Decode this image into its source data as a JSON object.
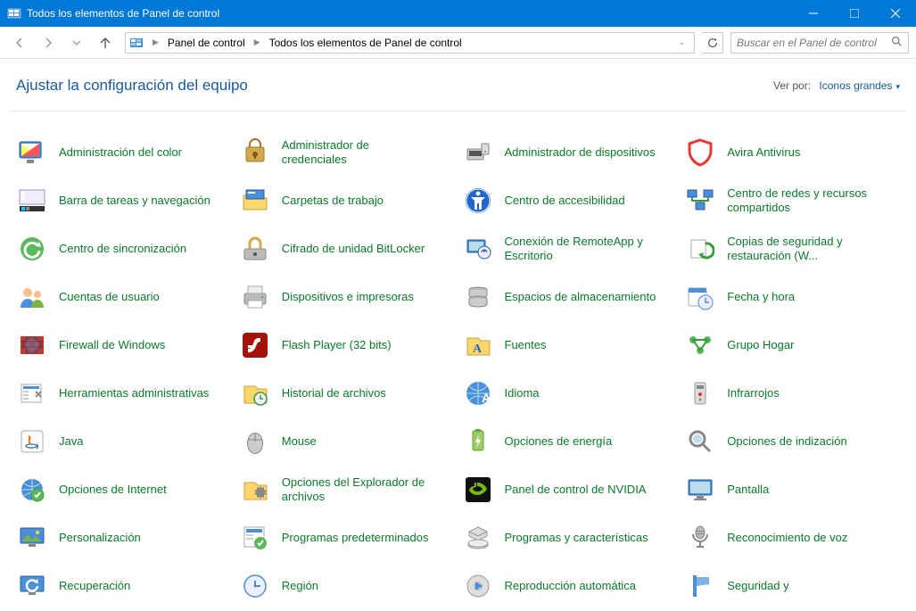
{
  "window": {
    "title": "Todos los elementos de Panel de control"
  },
  "breadcrumb": {
    "parts": [
      "Panel de control",
      "Todos los elementos de Panel de control"
    ]
  },
  "search": {
    "placeholder": "Buscar en el Panel de control"
  },
  "header": {
    "title": "Ajustar la configuración del equipo",
    "view_label": "Ver por:",
    "view_value": "Iconos grandes"
  },
  "items": [
    {
      "icon": "color-management-icon",
      "label": "Administración del color"
    },
    {
      "icon": "credential-manager-icon",
      "label": "Administrador de credenciales"
    },
    {
      "icon": "device-manager-icon",
      "label": "Administrador de dispositivos"
    },
    {
      "icon": "avira-icon",
      "label": "Avira Antivirus"
    },
    {
      "icon": "taskbar-icon",
      "label": "Barra de tareas y navegación"
    },
    {
      "icon": "work-folders-icon",
      "label": "Carpetas de trabajo"
    },
    {
      "icon": "ease-of-access-icon",
      "label": "Centro de accesibilidad"
    },
    {
      "icon": "network-sharing-icon",
      "label": "Centro de redes y recursos compartidos"
    },
    {
      "icon": "sync-center-icon",
      "label": "Centro de sincronización"
    },
    {
      "icon": "bitlocker-icon",
      "label": "Cifrado de unidad BitLocker"
    },
    {
      "icon": "remoteapp-icon",
      "label": "Conexión de RemoteApp y Escritorio"
    },
    {
      "icon": "backup-restore-icon",
      "label": "Copias de seguridad y restauración (W..."
    },
    {
      "icon": "user-accounts-icon",
      "label": "Cuentas de usuario"
    },
    {
      "icon": "devices-printers-icon",
      "label": "Dispositivos e impresoras"
    },
    {
      "icon": "storage-spaces-icon",
      "label": "Espacios de almacenamiento"
    },
    {
      "icon": "date-time-icon",
      "label": "Fecha y hora"
    },
    {
      "icon": "firewall-icon",
      "label": "Firewall de Windows"
    },
    {
      "icon": "flash-player-icon",
      "label": "Flash Player (32 bits)"
    },
    {
      "icon": "fonts-icon",
      "label": "Fuentes"
    },
    {
      "icon": "homegroup-icon",
      "label": "Grupo Hogar"
    },
    {
      "icon": "admin-tools-icon",
      "label": "Herramientas administrativas"
    },
    {
      "icon": "file-history-icon",
      "label": "Historial de archivos"
    },
    {
      "icon": "language-icon",
      "label": "Idioma"
    },
    {
      "icon": "infrared-icon",
      "label": "Infrarrojos"
    },
    {
      "icon": "java-icon",
      "label": "Java"
    },
    {
      "icon": "mouse-icon",
      "label": "Mouse"
    },
    {
      "icon": "power-options-icon",
      "label": "Opciones de energía"
    },
    {
      "icon": "indexing-options-icon",
      "label": "Opciones de indización"
    },
    {
      "icon": "internet-options-icon",
      "label": "Opciones de Internet"
    },
    {
      "icon": "folder-options-icon",
      "label": "Opciones del Explorador de archivos"
    },
    {
      "icon": "nvidia-icon",
      "label": "Panel de control de NVIDIA"
    },
    {
      "icon": "display-icon",
      "label": "Pantalla"
    },
    {
      "icon": "personalization-icon",
      "label": "Personalización"
    },
    {
      "icon": "default-programs-icon",
      "label": "Programas predeterminados"
    },
    {
      "icon": "programs-features-icon",
      "label": "Programas y características"
    },
    {
      "icon": "speech-recognition-icon",
      "label": "Reconocimiento de voz"
    },
    {
      "icon": "recovery-icon",
      "label": "Recuperación"
    },
    {
      "icon": "region-icon",
      "label": "Región"
    },
    {
      "icon": "autoplay-icon",
      "label": "Reproducción automática"
    },
    {
      "icon": "security-maintenance-icon",
      "label": "Seguridad y"
    }
  ],
  "icon_svg": {
    "color-management-icon": "<svg viewBox='0 0 32 32'><rect x='2' y='4' width='24' height='18' rx='2' fill='#4a90d9' stroke='#2c5aa0'/><rect x='4' y='6' width='20' height='14' fill='#fff'/><path d='M4 6 L24 20 L4 20 Z' fill='#ff6'/><path d='M24 6 L24 20 L4 20 Z' fill='#f55'/><rect x='10' y='24' width='8' height='4' fill='#888'/></svg>",
    "credential-manager-icon": "<svg viewBox='0 0 32 32'><rect x='6' y='10' width='20' height='16' rx='2' fill='#d4a94c' stroke='#9c7a2e'/><circle cx='16' cy='18' r='3' fill='#7a5c1e'/><rect x='15' y='18' width='2' height='5' fill='#7a5c1e'/><path d='M10 10 V7 a6 6 0 0 1 12 0 V10' fill='none' stroke='#9c7a2e' stroke-width='2'/></svg>",
    "device-manager-icon": "<svg viewBox='0 0 32 32'><rect x='4' y='12' width='18' height='12' rx='1' fill='#ccc' stroke='#888'/><rect x='6' y='14' width='14' height='6' fill='#555'/><rect x='20' y='6' width='8' height='12' rx='1' fill='#ddd' stroke='#888'/><circle cx='24' cy='15' r='1' fill='#888'/></svg>",
    "avira-icon": "<svg viewBox='0 0 32 32'><path d='M16 2 L28 6 V14 C28 22 22 28 16 30 C10 28 4 22 4 14 V6 Z' fill='none' stroke='#e53935' stroke-width='3'/></svg>",
    "taskbar-icon": "<svg viewBox='0 0 32 32'><rect x='2' y='4' width='28' height='16' fill='#eef' stroke='#99b'/><rect x='2' y='22' width='28' height='6' fill='#333'/><rect x='4' y='23' width='4' height='4' fill='#0cf'/><rect x='9' y='23' width='4' height='4' fill='#888'/><rect x='4' y='6' width='4' height='4' fill='#fff'/><rect x='4' y='11' width='4' height='4' fill='#fff'/></svg>",
    "work-folders-icon": "<svg viewBox='0 0 32 32'><path d='M3 10 h10 l3 3 h13 v13 H3 Z' fill='#ffd76a' stroke='#c9a23a'/><rect x='6' y='4' width='20' height='10' fill='#4a90d9' stroke='#2c5aa0'/><rect x='8' y='6' width='8' height='2' fill='#fff'/></svg>",
    "ease-of-access-icon": "<svg viewBox='0 0 32 32'><circle cx='16' cy='16' r='14' fill='#1e66c9'/><circle cx='16' cy='8' r='2.5' fill='#fff'/><path d='M8 12 h16 l-4 4 v10 h-3 v-7 h-2 v7 h-3 v-10 Z' fill='#fff'/><circle cx='16' cy='16' r='13' fill='none' stroke='#fff' stroke-width='1'/></svg>",
    "network-sharing-icon": "<svg viewBox='0 0 32 32'><rect x='2' y='4' width='10' height='8' fill='#4a90d9' stroke='#2c5aa0'/><rect x='20' y='4' width='10' height='8' fill='#4a90d9' stroke='#2c5aa0'/><rect x='11' y='18' width='10' height='8' fill='#4a90d9' stroke='#2c5aa0'/><path d='M7 12 V16 H25 V12 M16 16 V18' stroke='#3a9c3a' stroke-width='2' fill='none'/></svg>",
    "sync-center-icon": "<svg viewBox='0 0 32 32'><circle cx='16' cy='16' r='13' fill='#5cb85c'/><path d='M22 12 a8 8 0 1 0 2 6' fill='none' stroke='#fff' stroke-width='3'/><path d='M24 8 l2 6 l-6 -1 Z' fill='#fff'/></svg>",
    "bitlocker-icon": "<svg viewBox='0 0 32 32'><rect x='4' y='16' width='24' height='12' rx='2' fill='#bbb' stroke='#888'/><path d='M10 16 V10 a6 6 0 0 1 12 0 V16' fill='none' stroke='#d4a94c' stroke-width='3'/><circle cx='16' cy='22' r='2' fill='#555'/></svg>",
    "remoteapp-icon": "<svg viewBox='0 0 32 32'><rect x='4' y='6' width='20' height='14' rx='1' fill='#4a90d9' stroke='#2c5aa0'/><rect x='6' y='8' width='16' height='10' fill='#bde'/><circle cx='23' cy='20' r='7' fill='#eef' stroke='#2c5aa0'/><path d='M20 20 a3 3 0 1 1 6 0' fill='none' stroke='#2c5aa0'/><circle cx='23' cy='18' r='1.5' fill='#2c5aa0'/></svg>",
    "backup-restore-icon": "<svg viewBox='0 0 32 32'><rect x='6' y='6' width='16' height='20' fill='#fff' stroke='#aaa'/><path d='M22 10 a8 8 0 1 1 -4 14' fill='none' stroke='#3a9c3a' stroke-width='3'/><path d='M14 22 l4 4 l2 -6 Z' fill='#3a9c3a'/></svg>",
    "user-accounts-icon": "<svg viewBox='0 0 32 32'><circle cx='11' cy='11' r='5' fill='#f7c089'/><path d='M3 28 a8 10 0 0 1 16 0 Z' fill='#4a90d9'/><circle cx='22' cy='13' r='4' fill='#f7c089'/><path d='M15 28 a7 9 0 0 1 14 0 Z' fill='#7cb342'/></svg>",
    "devices-printers-icon": "<svg viewBox='0 0 32 32'><rect x='4' y='12' width='24' height='12' rx='2' fill='#bbb' stroke='#888'/><rect x='8' y='4' width='16' height='8' fill='#eee' stroke='#aaa'/><rect x='8' y='20' width='16' height='8' fill='#fff' stroke='#aaa'/><circle cx='24' cy='16' r='1.5' fill='#5cb85c'/></svg>",
    "storage-spaces-icon": "<svg viewBox='0 0 32 32'><ellipse cx='16' cy='8' rx='10' ry='3' fill='#bbb' stroke='#888'/><path d='M6 8 V14 a10 3 0 0 0 20 0 V8' fill='#ccc' stroke='#888'/><ellipse cx='16' cy='18' rx='10' ry='3' fill='#bbb' stroke='#888'/><path d='M6 18 V24 a10 3 0 0 0 20 0 V18' fill='#ccc' stroke='#888'/></svg>",
    "date-time-icon": "<svg viewBox='0 0 32 32'><rect x='3' y='6' width='20' height='20' rx='2' fill='#fff' stroke='#aaa'/><rect x='3' y='6' width='20' height='5' fill='#4a90d9'/><circle cx='22' cy='22' r='8' fill='#eef' stroke='#4a90d9'/><path d='M22 17 V22 H26' stroke='#4a90d9' stroke-width='1.5' fill='none'/></svg>",
    "firewall-icon": "<svg viewBox='0 0 32 32'><rect x='3' y='6' width='26' height='20' fill='#c0392b'/><path d='M3 12 H29 M3 18 H29 M10 6 V12 M20 6 V12 M6 12 V18 M16 12 V18 M26 12 V18 M10 18 V26 M20 18 V26' stroke='#7b241c' stroke-width='1'/><circle cx='16' cy='16' r='9' fill='none' stroke='#2c5aa0' stroke-width='1'/><circle cx='16' cy='16' r='7' fill='#4a90d9' fill-opacity='.4'/></svg>",
    "flash-player-icon": "<svg viewBox='0 0 32 32'><rect x='2' y='2' width='28' height='28' rx='4' fill='#a3130a'/><path d='M20 8 c-4 0 -5 3 -6 6 c-1 3 -2 6 -6 6 v4 c6 0 8 -4 9 -7 c1 -3 2 -5 5 -5 V8 Z' fill='#fff'/><rect x='8' y='16' width='8' height='3' fill='#fff'/></svg>",
    "fonts-icon": "<svg viewBox='0 0 32 32'><path d='M4 8 h12 l3 3 h10 v16 H4 Z' fill='#ffd76a' stroke='#c9a23a'/><text x='15' y='24' font-size='14' fill='#1e66c9' text-anchor='middle' font-family='serif' font-weight='bold'>A</text></svg>",
    "homegroup-icon": "<svg viewBox='0 0 32 32'><circle cx='8' cy='10' r='4' fill='#5cb85c'/><circle cx='24' cy='10' r='4' fill='#5cb85c'/><circle cx='16' cy='22' r='4' fill='#5cb85c'/><path d='M8 10 L24 10 L16 22 Z' fill='none' stroke='#3a9c3a' stroke-width='2'/></svg>",
    "admin-tools-icon": "<svg viewBox='0 0 32 32'><rect x='4' y='6' width='22' height='20' fill='#fff' stroke='#aaa'/><rect x='6' y='8' width='18' height='3' fill='#4a90d9'/><rect x='6' y='13' width='6' height='2' fill='#ccc'/><rect x='6' y='17' width='6' height='2' fill='#ccc'/><rect x='6' y='21' width='6' height='2' fill='#ccc'/><path d='M20 14 l6 6 M26 14 l-6 6' stroke='#888' stroke-width='2'/></svg>",
    "file-history-icon": "<svg viewBox='0 0 32 32'><path d='M4 8 h12 l3 3 h10 v16 H4 Z' fill='#ffd76a' stroke='#c9a23a'/><circle cx='22' cy='22' r='7' fill='#eef' stroke='#3a9c3a' stroke-width='1.5'/><path d='M22 18 V22 H25' stroke='#3a9c3a' stroke-width='1.5' fill='none'/></svg>",
    "language-icon": "<svg viewBox='0 0 32 32'><circle cx='16' cy='16' r='13' fill='#4a90d9'/><path d='M3 16 H29 M16 3 V29 M6 8 Q16 18 26 8 M6 24 Q16 14 26 24' stroke='#bde' stroke-width='1' fill='none'/><text x='20' y='26' font-size='14' fill='#fff' font-weight='bold'>A</text></svg>",
    "infrared-icon": "<svg viewBox='0 0 32 32'><rect x='10' y='4' width='12' height='24' rx='2' fill='#ddd' stroke='#999'/><rect x='12' y='7' width='8' height='4' fill='#888'/><circle cx='16' cy='17' r='2' fill='#d33'/><circle cx='16' cy='23' r='1.5' fill='#888'/></svg>",
    "java-icon": "<svg viewBox='0 0 32 32'><rect x='4' y='4' width='24' height='24' rx='3' fill='#fff' stroke='#aaa'/><path d='M12 10 c4 2 -2 5 2 8' stroke='#e76f00' stroke-width='2' fill='none'/><ellipse cx='15' cy='21' rx='6' ry='2' fill='none' stroke='#5382a1' stroke-width='1.5'/><path d='M21 19 a3 3 0 0 1 0 5' stroke='#5382a1' stroke-width='1.5' fill='none'/></svg>",
    "mouse-icon": "<svg viewBox='0 0 32 32'><ellipse cx='16' cy='18' rx='9' ry='12' fill='#888' /><ellipse cx='16' cy='18' rx='8' ry='11' fill='#ccc'/><path d='M16 7 V16 M8 14 H24' stroke='#888' stroke-width='1'/></svg>",
    "power-options-icon": "<svg viewBox='0 0 32 32'><rect x='10' y='4' width='12' height='22' rx='2' fill='#9ccc65' stroke='#689f38'/><rect x='13' y='2' width='6' height='3' fill='#689f38'/><path d='M17 8 l-4 9 h3 l-2 7 l5 -10 h-3 Z' fill='#fff'/></svg>",
    "indexing-options-icon": "<svg viewBox='0 0 32 32'><circle cx='13' cy='13' r='8' fill='none' stroke='#888' stroke-width='3'/><path d='M19 19 l8 8' stroke='#888' stroke-width='3'/><circle cx='13' cy='13' r='5' fill='#bde'/></svg>",
    "internet-options-icon": "<svg viewBox='0 0 32 32'><circle cx='16' cy='16' r='12' fill='#4a90d9'/><path d='M4 16 H28 M16 4 V28 M7 9 Q16 16 25 9 M7 23 Q16 16 25 23' stroke='#bde' stroke-width='1' fill='none'/><circle cx='22' cy='22' r='7' fill='#5cb85c' stroke='#3a9c3a'/><path d='M19 22 l2 2 l4 -5' stroke='#fff' stroke-width='2' fill='none'/></svg>",
    "folder-options-icon": "<svg viewBox='0 0 32 32'><path d='M4 8 h12 l3 3 h10 v16 H4 Z' fill='#ffd76a' stroke='#c9a23a'/><path d='M22 18 m-4 0 a4 4 0 1 0 8 0 a4 4 0 1 0 -8 0' fill='#888'/><path d='M22 11 l1 3 l3 -1 l0 3 l3 1 l-2 2 l2 2 l-3 1 l0 3 l-3 -1 l-1 3 l-1 -3 l-3 1 l0 -3 l-3 -1 l2 -2 l-2 -2 l3 -1 l0 -3 l3 1 Z' fill='#888'/></svg>",
    "nvidia-icon": "<svg viewBox='0 0 32 32'><rect x='2' y='2' width='28' height='28' rx='3' fill='#111'/><path d='M12 8 v4 c-4 0 -6 3 -6 5 c2 3 5 5 9 5 c5 0 9 -3 11 -7 c-2 -4 -6 -7 -11 -7 v4 c3 0 5 2 6 3 c-1 2 -3 3 -6 3 c-2 0 -4 -1 -5 -3 c1 -1 2 -2 4 -2 v-5 Z' fill='#76b900'/></svg>",
    "display-icon": "<svg viewBox='0 0 32 32'><rect x='3' y='5' width='26' height='17' rx='1' fill='#4a90d9' stroke='#2c5aa0'/><rect x='5' y='7' width='22' height='13' fill='#bde'/><rect x='12' y='23' width='8' height='3' fill='#888'/><rect x='9' y='26' width='14' height='2' fill='#888'/></svg>",
    "personalization-icon": "<svg viewBox='0 0 32 32'><rect x='3' y='5' width='26' height='17' rx='1' fill='#4a90d9' stroke='#2c5aa0'/><path d='M5 20 l6 -8 l5 6 l4 -4 l6 6 Z' fill='#7cb342'/><circle cx='22' cy='10' r='2' fill='#ffd54f'/><rect x='12' y='23' width='8' height='3' fill='#888'/></svg>",
    "default-programs-icon": "<svg viewBox='0 0 32 32'><rect x='4' y='4' width='22' height='22' fill='#fff' stroke='#aaa'/><rect x='6' y='6' width='18' height='4' fill='#4a90d9'/><rect x='6' y='12' width='8' height='2' fill='#ccc'/><rect x='6' y='16' width='8' height='2' fill='#ccc'/><circle cx='22' cy='22' r='7' fill='#5cb85c'/><path d='M19 22 l2 2 l4 -5' stroke='#fff' stroke-width='2' fill='none'/></svg>",
    "programs-features-icon": "<svg viewBox='0 0 32 32'><path d='M16 4 l10 5 v5 l-10 5 l-10 -5 v-5 Z' fill='#ddd' stroke='#999'/><path d='M6 9 l10 5 l10 -5' fill='none' stroke='#999'/><ellipse cx='16' cy='24' rx='11' ry='4' fill='#ccc' stroke='#999'/><ellipse cx='16' cy='22' rx='11' ry='4' fill='#eee' stroke='#999'/></svg>",
    "speech-recognition-icon": "<svg viewBox='0 0 32 32'><ellipse cx='16' cy='10' rx='5' ry='7' fill='#bbb' stroke='#888'/><rect x='11' y='8' width='10' height='1' fill='#888'/><rect x='11' y='11' width='10' height='1' fill='#888'/><path d='M8 12 a8 8 0 0 0 16 0' fill='none' stroke='#888' stroke-width='2'/><path d='M16 20 V26 M12 26 H20' stroke='#888' stroke-width='2'/></svg>",
    "recovery-icon": "<svg viewBox='0 0 32 32'><rect x='3' y='5' width='26' height='17' rx='1' fill='#4a90d9' stroke='#2c5aa0'/><path d='M20 11 a6 6 0 1 0 2 5' fill='none' stroke='#fff' stroke-width='2.5'/><path d='M22 8 l1 5 l-5 -1 Z' fill='#fff'/><rect x='12' y='23' width='8' height='3' fill='#888'/></svg>",
    "region-icon": "<svg viewBox='0 0 32 32'><circle cx='16' cy='16' r='12' fill='#eef' stroke='#4a90d9' stroke-width='1.5'/><path d='M16 10 V16 H22' stroke='#4a90d9' stroke-width='2' fill='none'/><circle cx='16' cy='16' r='1.5' fill='#4a90d9'/></svg>",
    "autoplay-icon": "<svg viewBox='0 0 32 32'><circle cx='16' cy='16' r='12' fill='#ddd' stroke='#999'/><circle cx='16' cy='16' r='4' fill='#fff' stroke='#999'/><path d='M13 11 l8 5 l-8 5 Z' fill='#4a90d9'/></svg>",
    "security-maintenance-icon": "<svg viewBox='0 0 32 32'><rect x='8' y='4' width='4' height='24' fill='#4a90d9'/><path d='M12 6 h14 v8 l-14 2 Z' fill='#4a90d9'/><path d='M12 6 h14 v8 l-14 2 Z' fill='#fff' fill-opacity='.3'/></svg>"
  }
}
